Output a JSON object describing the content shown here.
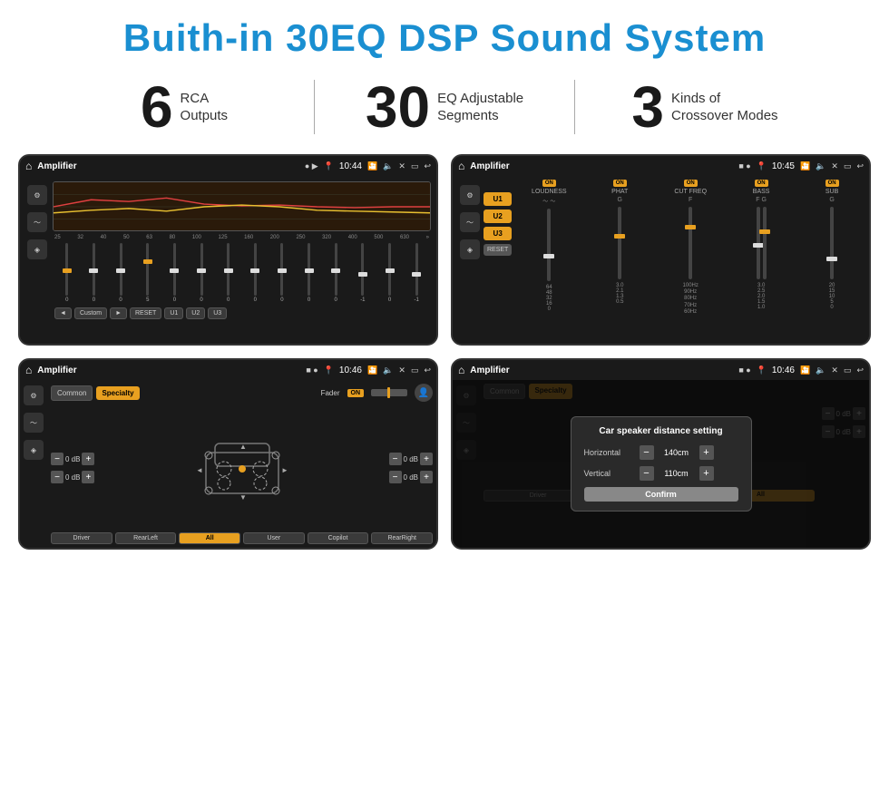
{
  "title": "Buith-in 30EQ DSP Sound System",
  "stats": [
    {
      "number": "6",
      "label": "RCA\nOutputs"
    },
    {
      "number": "30",
      "label": "EQ Adjustable\nSegments"
    },
    {
      "number": "3",
      "label": "Kinds of\nCrossover Modes"
    }
  ],
  "screens": [
    {
      "id": "eq-screen",
      "status": {
        "title": "Amplifier",
        "time": "10:44"
      },
      "type": "eq"
    },
    {
      "id": "crossover-screen",
      "status": {
        "title": "Amplifier",
        "time": "10:45"
      },
      "type": "crossover"
    },
    {
      "id": "fader-screen",
      "status": {
        "title": "Amplifier",
        "time": "10:46"
      },
      "type": "fader"
    },
    {
      "id": "distance-screen",
      "status": {
        "title": "Amplifier",
        "time": "10:46"
      },
      "type": "distance",
      "dialog": {
        "title": "Car speaker distance setting",
        "horizontal_label": "Horizontal",
        "horizontal_value": "140cm",
        "vertical_label": "Vertical",
        "vertical_value": "110cm",
        "confirm_label": "Confirm"
      }
    }
  ],
  "eq": {
    "frequencies": [
      "25",
      "32",
      "40",
      "50",
      "63",
      "80",
      "100",
      "125",
      "160",
      "200",
      "250",
      "320",
      "400",
      "500",
      "630"
    ],
    "values": [
      "0",
      "0",
      "0",
      "5",
      "0",
      "0",
      "0",
      "0",
      "0",
      "0",
      "0",
      "-1",
      "0",
      "-1"
    ],
    "buttons": [
      "◄",
      "Custom",
      "►",
      "RESET",
      "U1",
      "U2",
      "U3"
    ]
  },
  "crossover": {
    "u_buttons": [
      "U1",
      "U2",
      "U3"
    ],
    "groups": [
      {
        "label": "LOUDNESS",
        "on": true
      },
      {
        "label": "PHAT",
        "on": true
      },
      {
        "label": "CUT FREQ",
        "on": true
      },
      {
        "label": "BASS",
        "on": true
      },
      {
        "label": "SUB",
        "on": true
      }
    ],
    "reset_label": "RESET"
  },
  "fader": {
    "common_label": "Common",
    "specialty_label": "Specialty",
    "fader_label": "Fader",
    "on_label": "ON",
    "db_values": [
      "0 dB",
      "0 dB",
      "0 dB",
      "0 dB"
    ],
    "buttons": [
      "Driver",
      "RearLeft",
      "All",
      "Copilot",
      "User",
      "RearRight"
    ]
  }
}
